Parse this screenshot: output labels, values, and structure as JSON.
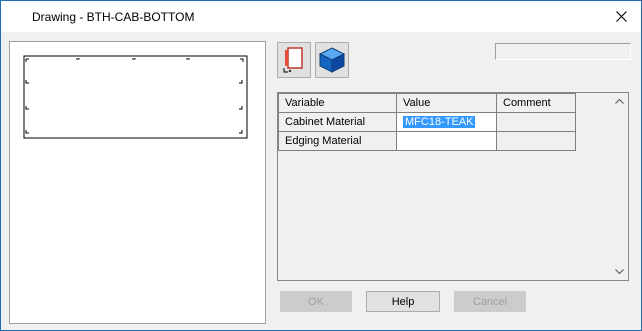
{
  "window": {
    "title": "Drawing - BTH-CAB-BOTTOM"
  },
  "toolbar": {
    "sheet_icon": "drawing-sheet-icon",
    "cube_icon": "3d-cube-icon"
  },
  "grid": {
    "headers": {
      "variable": "Variable",
      "value": "Value",
      "comment": "Comment"
    },
    "rows": [
      {
        "variable": "Cabinet Material",
        "value": "MFC18-TEAK",
        "comment": "",
        "selected": true
      },
      {
        "variable": "Edging Material",
        "value": "",
        "comment": ""
      }
    ]
  },
  "buttons": {
    "ok": "OK",
    "help": "Help",
    "cancel": "Cancel"
  },
  "colors": {
    "selection": "#3399ff",
    "accent_cube": "#1565c0",
    "window_border": "#1f6fb5"
  }
}
